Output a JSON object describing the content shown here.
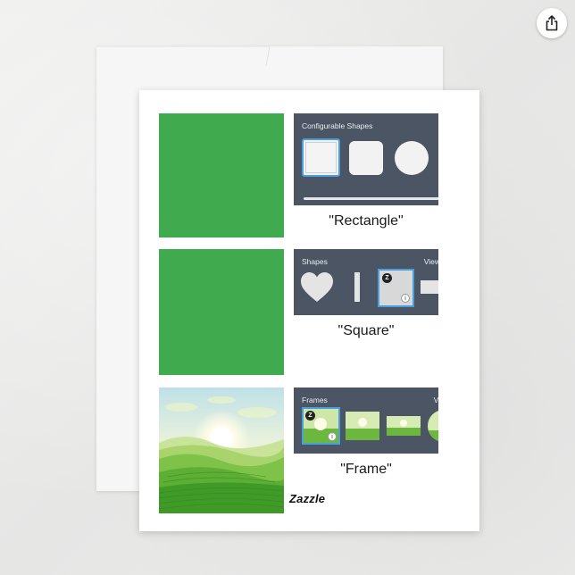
{
  "share": {
    "icon": "share-icon"
  },
  "card": {
    "sections": [
      {
        "panel_title": "Configurable Shapes",
        "caption": "\"Rectangle\""
      },
      {
        "panel_title": "Shapes",
        "panel_view": "View",
        "caption": "\"Square\""
      },
      {
        "panel_title": "Frames",
        "panel_view": "Vi",
        "caption": "\"Frame\""
      }
    ],
    "brand": "Zazzle",
    "badge_z": "Z",
    "badge_i": "i"
  },
  "colors": {
    "green": "#3faa4e",
    "panel": "#4b5563",
    "selection": "#4a9fe0"
  }
}
